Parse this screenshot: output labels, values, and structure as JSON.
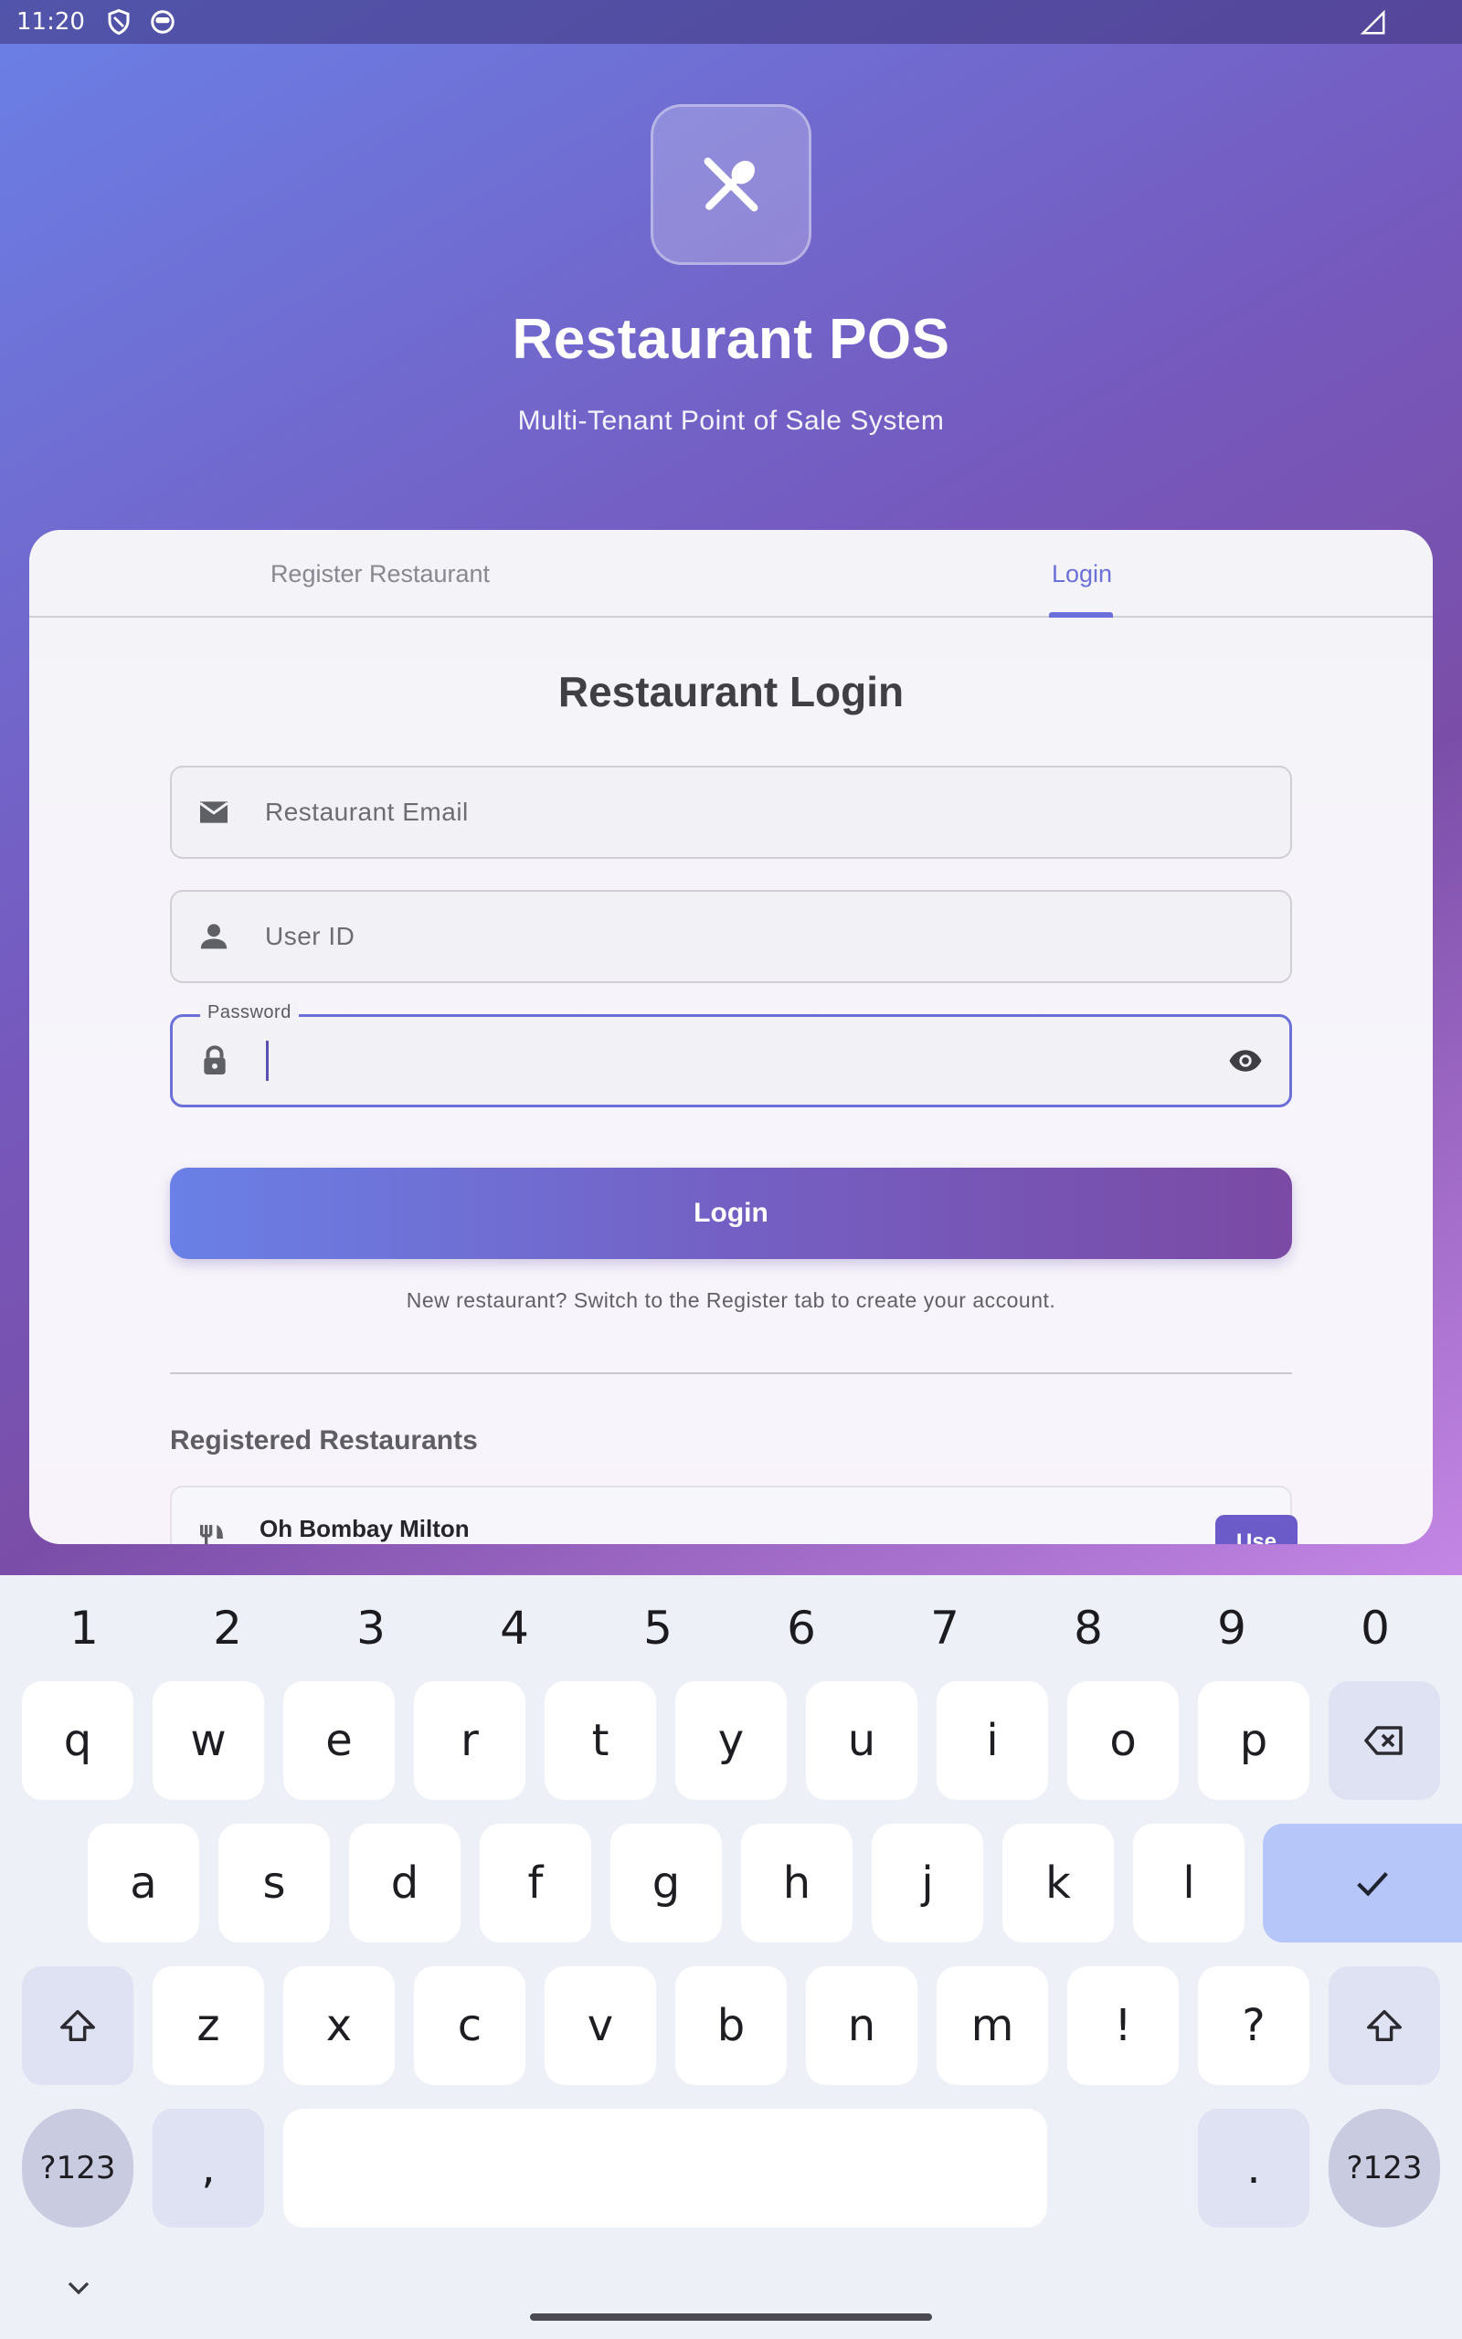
{
  "status_bar": {
    "time": "11:20",
    "icons": [
      "shield-icon",
      "face-icon",
      "signal-icon"
    ]
  },
  "app": {
    "logo_icon": "restaurant-cutlery-icon",
    "title": "Restaurant POS",
    "subtitle": "Multi-Tenant Point of Sale System"
  },
  "tabs": [
    {
      "label": "Register Restaurant",
      "active": false
    },
    {
      "label": "Login",
      "active": true
    }
  ],
  "login_form": {
    "title": "Restaurant Login",
    "email": {
      "placeholder": "Restaurant Email",
      "value": "",
      "icon": "email-icon"
    },
    "user_id": {
      "placeholder": "User ID",
      "value": "",
      "icon": "person-icon"
    },
    "password": {
      "label": "Password",
      "value": "",
      "icon": "lock-icon",
      "toggle_icon": "eye-icon",
      "focused": true
    },
    "submit_label": "Login",
    "hint": "New restaurant? Switch to the Register tab to create your account."
  },
  "registered": {
    "title": "Registered Restaurants",
    "items": [
      {
        "name": "Oh Bombay Milton",
        "icon": "restaurant-icon",
        "action_label": "Use"
      }
    ]
  },
  "keyboard": {
    "numbers": [
      "1",
      "2",
      "3",
      "4",
      "5",
      "6",
      "7",
      "8",
      "9",
      "0"
    ],
    "row1": [
      "q",
      "w",
      "e",
      "r",
      "t",
      "y",
      "u",
      "i",
      "o",
      "p"
    ],
    "row2": [
      "a",
      "s",
      "d",
      "f",
      "g",
      "h",
      "j",
      "k",
      "l"
    ],
    "row3": [
      "z",
      "x",
      "c",
      "v",
      "b",
      "n",
      "m",
      "!",
      "?"
    ],
    "symbols_label": "?123",
    "comma": ",",
    "period": ".",
    "accent_color": "#b6c6f8"
  },
  "colors": {
    "brand_gradient_start": "#6a80e6",
    "brand_gradient_end": "#7a4aa4",
    "active_tab": "#6b6fd8"
  }
}
